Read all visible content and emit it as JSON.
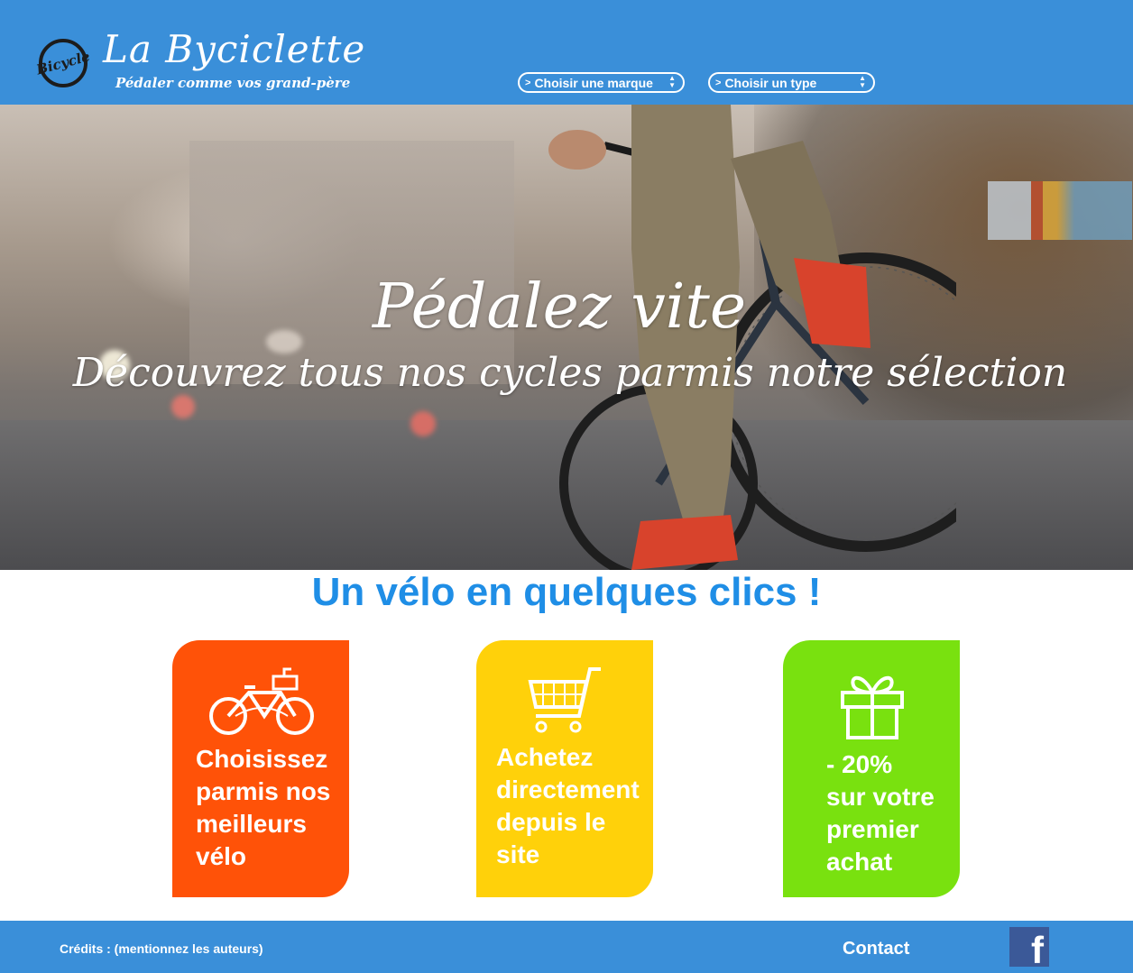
{
  "header": {
    "logo_text": "Bicycle",
    "title": "La Byciclette",
    "tagline": "Pédaler comme vos grand-père",
    "select_brand": {
      "caret": ">",
      "label": "Choisir une marque"
    },
    "select_type": {
      "caret": ">",
      "label": "Choisir un type"
    }
  },
  "hero": {
    "heading": "Pédalez vite",
    "subheading": "Découvrez tous nos cycles parmis notre sélection"
  },
  "features": {
    "title": "Un vélo en quelques clics !",
    "cards": [
      {
        "icon": "bicycle-icon",
        "lines": [
          "Choisissez",
          "parmis nos",
          "meilleurs",
          "vélo"
        ],
        "color": "#ff5208"
      },
      {
        "icon": "shopping-cart-icon",
        "lines": [
          "Achetez",
          "directement",
          "depuis le",
          "site"
        ],
        "color": "#ffd10a"
      },
      {
        "icon": "gift-icon",
        "lines": [
          "- 20%",
          "sur votre",
          "premier",
          "achat"
        ],
        "color": "#79e10f"
      }
    ]
  },
  "footer": {
    "credits": "Crédits : (mentionnez  les auteurs)",
    "contact": "Contact",
    "social_icon": "facebook-icon",
    "social_glyph": "f"
  },
  "colors": {
    "header_bg": "#3a8fd9",
    "title_blue": "#1f8ee6"
  }
}
